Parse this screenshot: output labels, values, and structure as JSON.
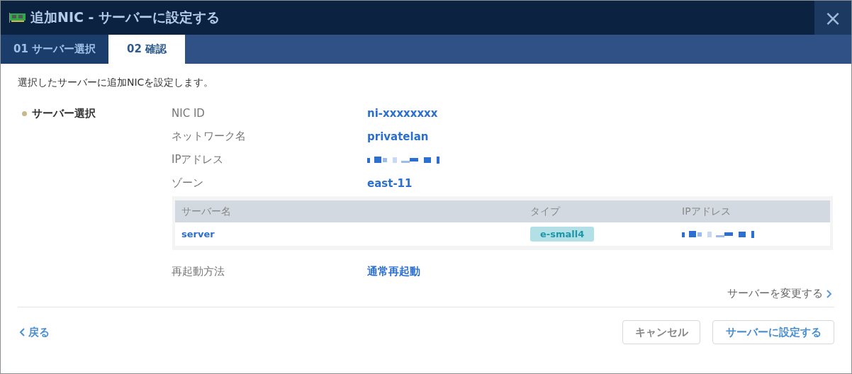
{
  "window": {
    "title": "追加NIC - サーバーに設定する",
    "close": "×"
  },
  "tabs": [
    {
      "label": "01 サーバー選択",
      "selected": false
    },
    {
      "label": "02 確認",
      "selected": true
    }
  ],
  "intro": "選択したサーバーに追加NICを設定します。",
  "section": "サーバー選択",
  "details": [
    {
      "label": "NIC ID",
      "value": "ni-xxxxxxxx",
      "kind": "text"
    },
    {
      "label": "ネットワーク名",
      "value": "privatelan",
      "kind": "text"
    },
    {
      "label": "IPアドレス",
      "kind": "redacted"
    },
    {
      "label": "ゾーン",
      "value": "east-11",
      "kind": "text"
    }
  ],
  "table": {
    "columns": [
      "サーバー名",
      "タイプ",
      "IPアドレス"
    ],
    "rows": [
      {
        "name": "server",
        "type": "e-small4"
      }
    ]
  },
  "restart": {
    "label": "再起動方法",
    "value": "通常再起動"
  },
  "change_link": "サーバーを変更する",
  "back_link": "戻る",
  "buttons": [
    "キャンセル",
    "サーバーに設定する"
  ]
}
